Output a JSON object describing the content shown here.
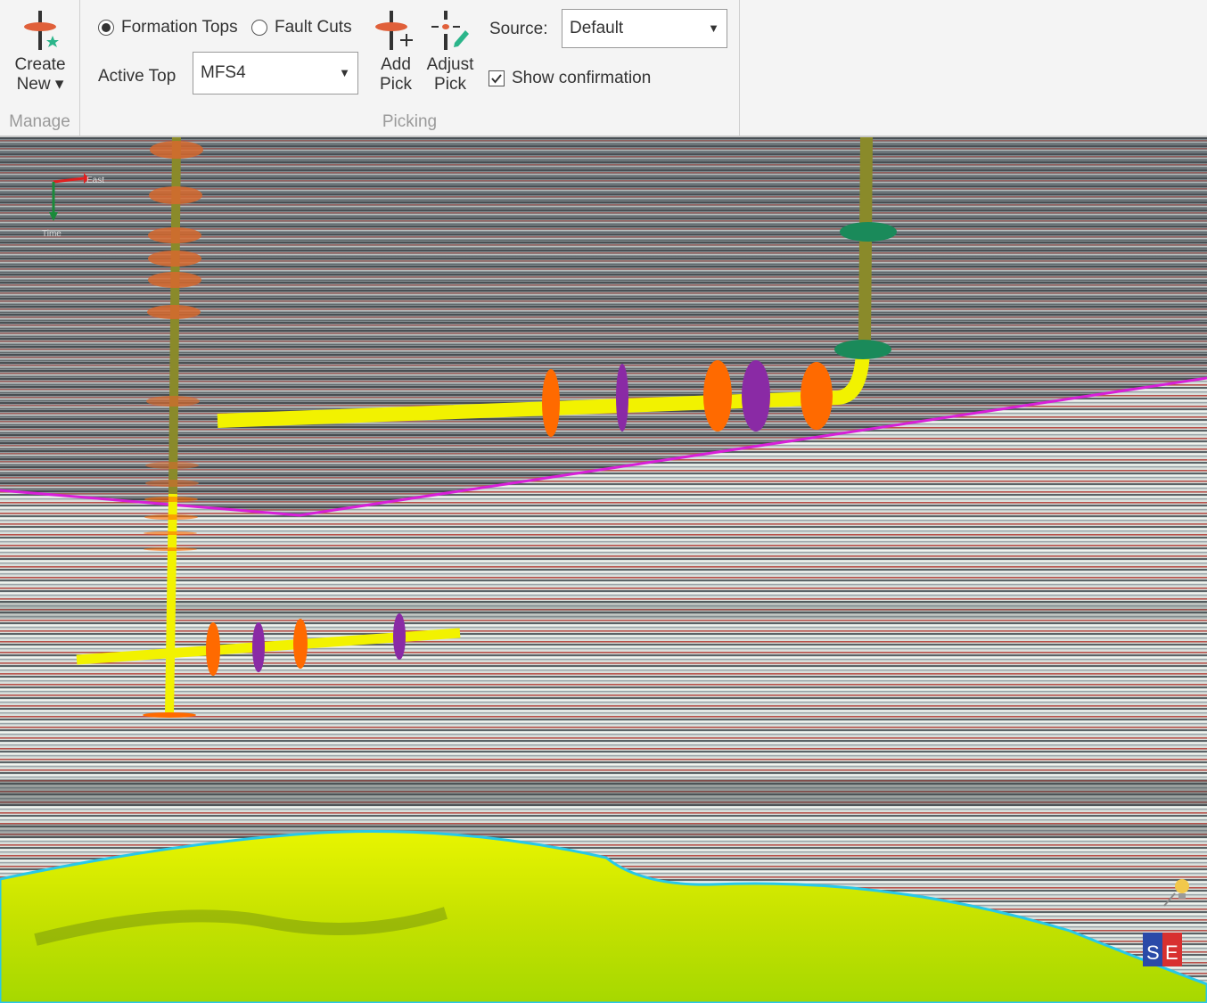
{
  "ribbon": {
    "manage": {
      "group_label": "Manage",
      "create_new": {
        "line1": "Create",
        "line2": "New ▾"
      }
    },
    "picking": {
      "group_label": "Picking",
      "mode_options": [
        {
          "label": "Formation Tops",
          "selected": true
        },
        {
          "label": "Fault Cuts",
          "selected": false
        }
      ],
      "active_top": {
        "label": "Active Top",
        "value": "MFS4"
      },
      "add_pick": {
        "line1": "Add",
        "line2": "Pick"
      },
      "adjust_pick": {
        "line1": "Adjust",
        "line2": "Pick"
      },
      "source": {
        "label": "Source:",
        "value": "Default"
      },
      "show_confirmation": {
        "label": "Show confirmation",
        "checked": true
      }
    }
  },
  "viewport": {
    "orientation": {
      "x_label": "East",
      "y_label": "Time"
    },
    "colors": {
      "horizon_line": "#d81fd8",
      "wellbore": "#f2f200",
      "wellbore_upper": "#8a8a2a",
      "formation_top_orange": "#ff6a00",
      "formation_top_purple": "#8a2aa5",
      "formation_top_green": "#1a8a5a",
      "surface": "#d8f000"
    }
  }
}
